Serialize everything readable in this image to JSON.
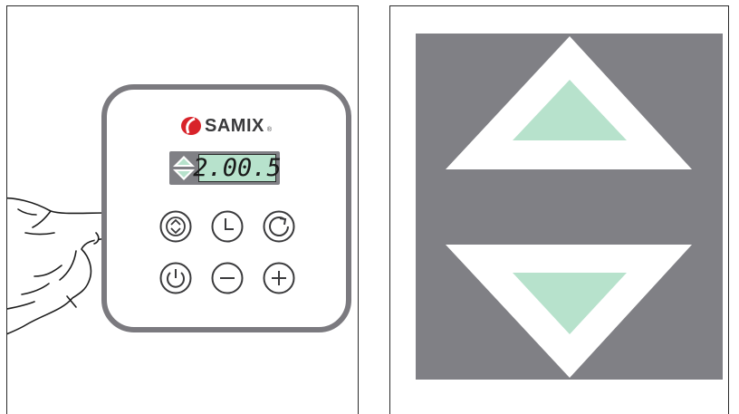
{
  "control_panel": {
    "brand_name": "SAMIX",
    "brand_mark": "®",
    "display_value": "2.00.5",
    "buttons": [
      {
        "name": "up-down-button",
        "icon": "up-down-chevron-icon"
      },
      {
        "name": "timer-button",
        "icon": "clock-icon"
      },
      {
        "name": "rotation-button",
        "icon": "rotate-icon"
      },
      {
        "name": "power-button",
        "icon": "power-icon"
      },
      {
        "name": "minus-button",
        "icon": "minus-icon"
      },
      {
        "name": "plus-button",
        "icon": "plus-icon"
      }
    ]
  },
  "colors": {
    "panel_gray": "#7b7a7f",
    "lcd_green": "#b7e2cc",
    "logo_red": "#d8232a",
    "dark_gray": "#808085"
  },
  "detail": {
    "subject": "up-down-arrow-key-closeup"
  }
}
